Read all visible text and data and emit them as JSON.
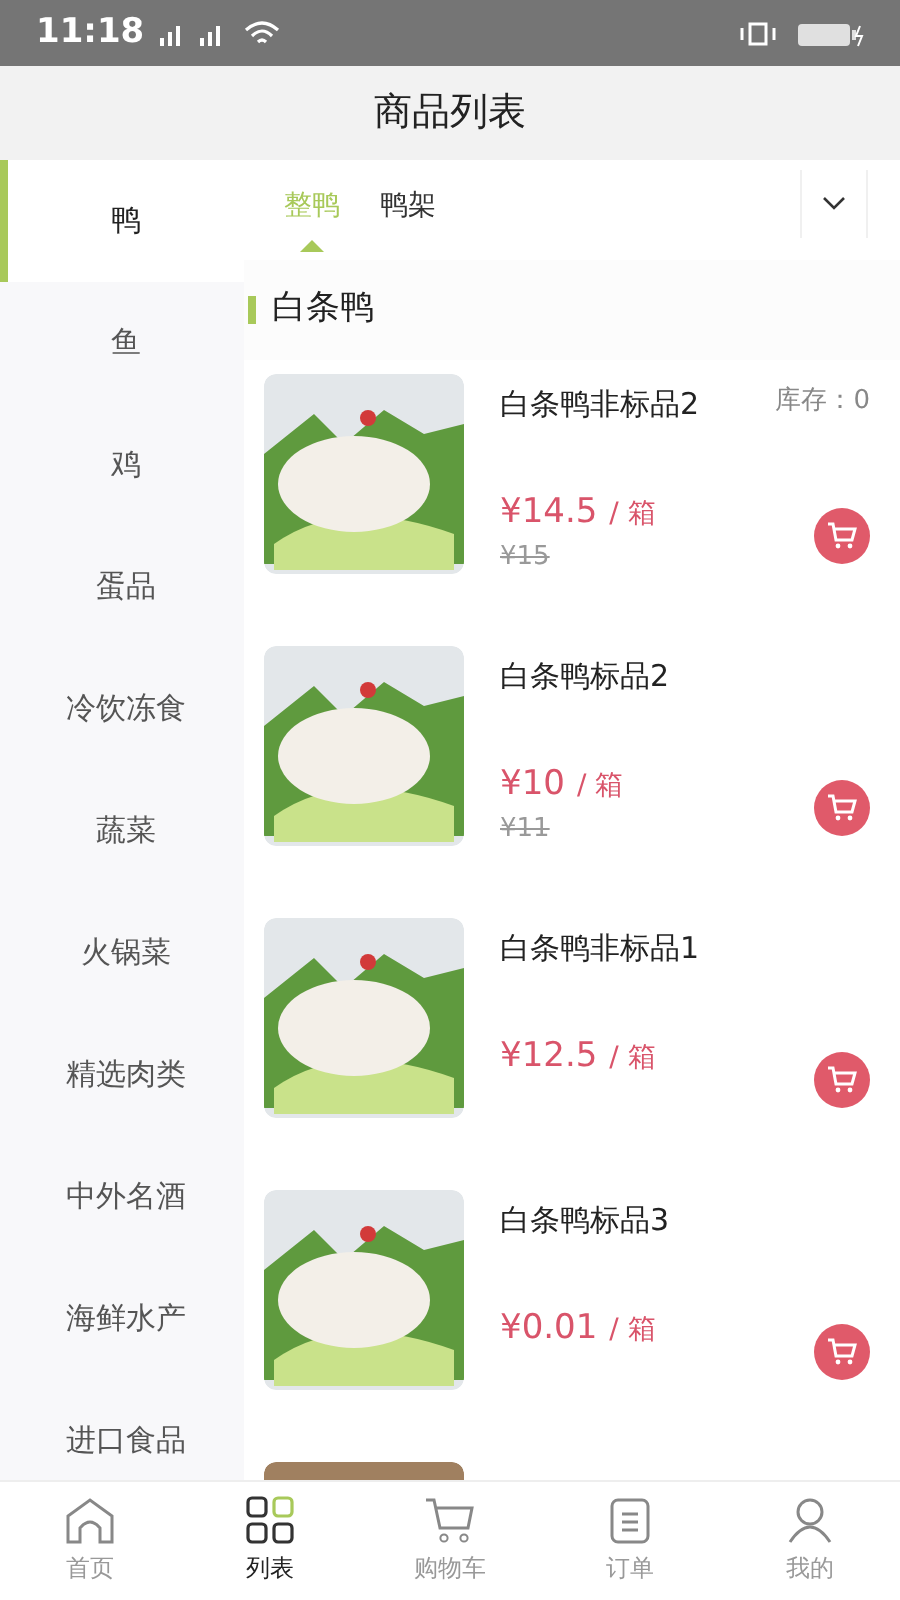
{
  "status_bar": {
    "time": "11:18"
  },
  "header": {
    "title": "商品列表"
  },
  "categories": [
    {
      "label": "鸭",
      "selected": true
    },
    {
      "label": "鱼",
      "selected": false
    },
    {
      "label": "鸡",
      "selected": false
    },
    {
      "label": "蛋品",
      "selected": false
    },
    {
      "label": "冷饮冻食",
      "selected": false
    },
    {
      "label": "蔬菜",
      "selected": false
    },
    {
      "label": "火锅菜",
      "selected": false
    },
    {
      "label": "精选肉类",
      "selected": false
    },
    {
      "label": "中外名酒",
      "selected": false
    },
    {
      "label": "海鲜水产",
      "selected": false
    },
    {
      "label": "进口食品",
      "selected": false
    }
  ],
  "subtabs": [
    {
      "label": "整鸭",
      "selected": true
    },
    {
      "label": "鸭架",
      "selected": false
    }
  ],
  "section_title": "白条鸭",
  "products": [
    {
      "name": "白条鸭非标品2",
      "stock": "库存：0",
      "price": "¥14.5",
      "unit": "/ 箱",
      "original_price": "¥15"
    },
    {
      "name": "白条鸭标品2",
      "price": "¥10",
      "unit": "/ 箱",
      "original_price": "¥11"
    },
    {
      "name": "白条鸭非标品1",
      "price": "¥12.5",
      "unit": "/ 箱"
    },
    {
      "name": "白条鸭标品3",
      "price": "¥0.01",
      "unit": "/ 箱"
    }
  ],
  "bottom_nav": [
    {
      "label": "首页",
      "selected": false
    },
    {
      "label": "列表",
      "selected": true
    },
    {
      "label": "购物车",
      "selected": false
    },
    {
      "label": "订单",
      "selected": false
    },
    {
      "label": "我的",
      "selected": false
    }
  ]
}
